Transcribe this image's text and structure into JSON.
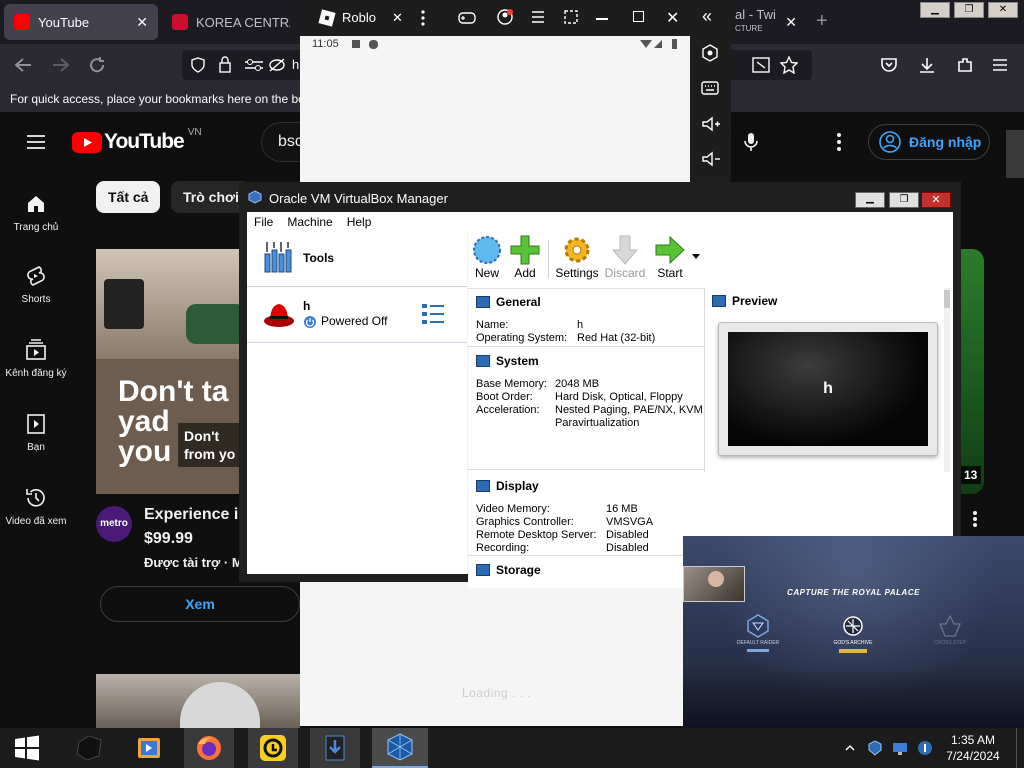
{
  "browser": {
    "tabs": [
      {
        "label": "YouTube",
        "close": "✕"
      },
      {
        "label": "KOREA CENTRAL T",
        "close": ""
      },
      {
        "label": "al - Twi",
        "close": "✕"
      }
    ],
    "tab_sub": "CTURE",
    "new_tab": "+",
    "bookmarks_hint": "For quick access, place your bookmarks here on the bo",
    "url_partial": "h"
  },
  "youtube": {
    "logo_text": "YouTube",
    "region": "VN",
    "search_value": "bsc",
    "signin": "Đăng nhập",
    "sidebar": [
      {
        "label": "Trang chủ",
        "icon": "home-icon"
      },
      {
        "label": "Shorts",
        "icon": "shorts-icon"
      },
      {
        "label": "Kênh đăng ký",
        "icon": "subscriptions-icon"
      },
      {
        "label": "Bạn",
        "icon": "you-icon"
      },
      {
        "label": "Video đã xem",
        "icon": "history-icon"
      }
    ],
    "chips": [
      "Tất cả",
      "Trò chơi"
    ],
    "ad": {
      "thumb_line1": "Don't ta",
      "thumb_line2": "yad",
      "thumb_line3": "you",
      "thumb_overlay1": "Don't",
      "thumb_overlay2": "from yo",
      "channel_badge": "metro",
      "title": "Experience iP",
      "price": "$99.99",
      "sponsored": "Được tài trợ · M",
      "cta": "Xem"
    },
    "right_duration": "13"
  },
  "roblox": {
    "title": "Roblo",
    "status_time": "11:05",
    "loading": "Loading . . ."
  },
  "vbox": {
    "title": "Oracle VM VirtualBox Manager",
    "menu": [
      "File",
      "Machine",
      "Help"
    ],
    "tools_label": "Tools",
    "vm": {
      "name": "h",
      "state": "Powered Off"
    },
    "toolbar": [
      {
        "label": "New",
        "disabled": false
      },
      {
        "label": "Add",
        "disabled": false
      },
      {
        "label": "Settings",
        "disabled": false
      },
      {
        "label": "Discard",
        "disabled": true
      },
      {
        "label": "Start",
        "disabled": false
      }
    ],
    "general": {
      "header": "General",
      "rows": [
        {
          "k": "Name:",
          "v": "h"
        },
        {
          "k": "Operating System:",
          "v": "Red Hat (32-bit)"
        }
      ]
    },
    "system": {
      "header": "System",
      "rows": [
        {
          "k": "Base Memory:",
          "v": "2048 MB"
        },
        {
          "k": "Boot Order:",
          "v": "Hard Disk, Optical, Floppy"
        },
        {
          "k": "Acceleration:",
          "v": "Nested Paging, PAE/NX, KVM"
        },
        {
          "k": "",
          "v": "Paravirtualization"
        }
      ]
    },
    "display": {
      "header": "Display",
      "rows": [
        {
          "k": "Video Memory:",
          "v": "16 MB"
        },
        {
          "k": "Graphics Controller:",
          "v": "VMSVGA"
        },
        {
          "k": "Remote Desktop Server:",
          "v": "Disabled"
        },
        {
          "k": "Recording:",
          "v": "Disabled"
        }
      ]
    },
    "storage_header": "Storage",
    "preview_header": "Preview",
    "preview_name": "h"
  },
  "game": {
    "banner": "CAPTURE THE ROYAL PALACE",
    "teams": [
      {
        "label": "DEFAULT RAIDER"
      },
      {
        "label": "GOD'S ARCHIVE"
      },
      {
        "label": "CROSS STEP"
      }
    ]
  },
  "taskbar": {
    "time": "1:35 AM",
    "date": "7/24/2024"
  },
  "colors": {
    "yt_red": "#ff0000",
    "signin_blue": "#3ea6ff",
    "vbox_blue": "#2d6cb5"
  }
}
